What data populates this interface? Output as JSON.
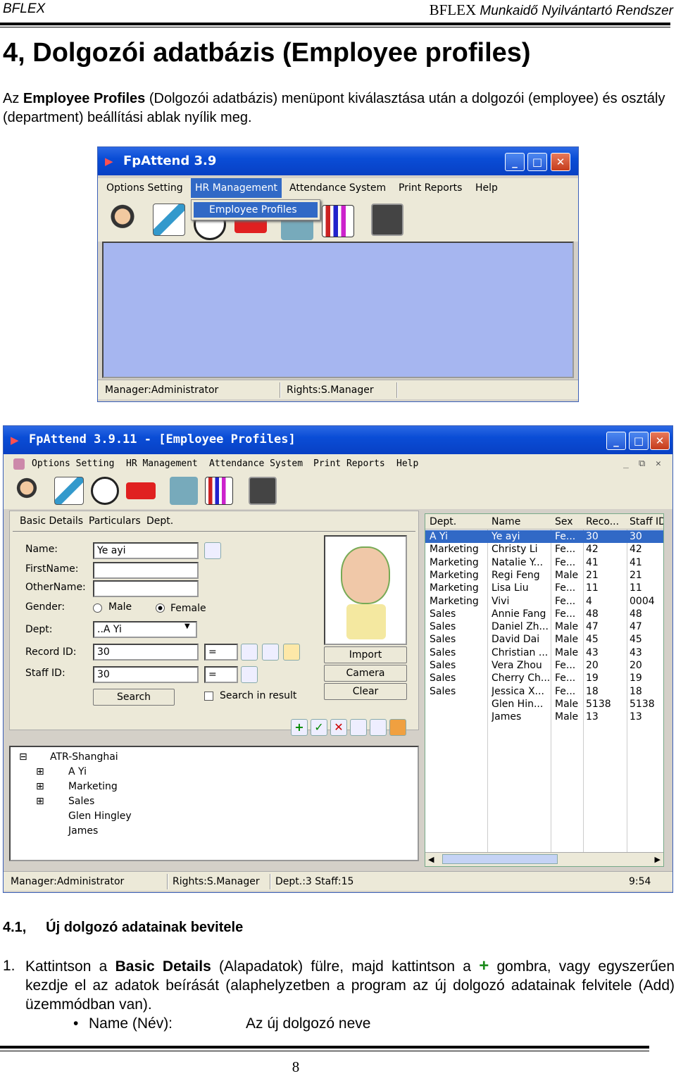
{
  "header": {
    "left": "BFLEX",
    "right_brand": "BFLEX",
    "right_title": "Munkaidő Nyilvántartó Rendszer"
  },
  "section": {
    "title": "4, Dolgozói adatbázis (Employee profiles)",
    "intro_prefix": "Az ",
    "intro_bold": "Employee Profiles",
    "intro_rest": " (Dolgozói adatbázis) menüpont kiválasztása után a dolgozói (employee) és osztály (department) beállítási ablak nyílik meg."
  },
  "screenshot1": {
    "title": "FpAttend 3.9",
    "menu": [
      "Options Setting",
      "HR Management",
      "Attendance System",
      "Print Reports",
      "Help"
    ],
    "dropdown_item": "Employee Profiles",
    "status_manager": "Manager:Administrator",
    "status_rights": "Rights:S.Manager"
  },
  "screenshot2": {
    "title": "FpAttend 3.9.11 - [Employee Profiles]",
    "menu": [
      "Options Setting",
      "HR Management",
      "Attendance System",
      "Print Reports",
      "Help"
    ],
    "tabs": [
      "Basic Details",
      "Particulars",
      "Dept."
    ],
    "form": {
      "name_label": "Name:",
      "name_value": "Ye ayi",
      "firstname_label": "FirstName:",
      "othername_label": "OtherName:",
      "gender_label": "Gender:",
      "male": "Male",
      "female": "Female",
      "dept_label": "Dept:",
      "dept_value": "..A Yi",
      "record_label": "Record ID:",
      "record_value": "30",
      "staff_label": "Staff ID:",
      "staff_value": "30",
      "op": "=",
      "search_button": "Search",
      "search_in_result": "Search in result",
      "import_button": "Import",
      "camera_button": "Camera",
      "clear_button": "Clear"
    },
    "tree": [
      "ATR-Shanghai",
      "A Yi",
      "Marketing",
      "Sales",
      "Glen Hingley",
      "James"
    ],
    "grid": {
      "columns": [
        "Dept.",
        "Name",
        "Sex",
        "Reco...",
        "Staff ID"
      ],
      "rows": [
        [
          "A Yi",
          "Ye ayi",
          "Fe...",
          "30",
          "30"
        ],
        [
          "Marketing",
          "Christy Li",
          "Fe...",
          "42",
          "42"
        ],
        [
          "Marketing",
          "Natalie Y...",
          "Fe...",
          "41",
          "41"
        ],
        [
          "Marketing",
          "Regi Feng",
          "Male",
          "21",
          "21"
        ],
        [
          "Marketing",
          "Lisa Liu",
          "Fe...",
          "11",
          "11"
        ],
        [
          "Marketing",
          "Vivi",
          "Fe...",
          "4",
          "0004"
        ],
        [
          "Sales",
          "Annie Fang",
          "Fe...",
          "48",
          "48"
        ],
        [
          "Sales",
          "Daniel Zh...",
          "Male",
          "47",
          "47"
        ],
        [
          "Sales",
          "David Dai",
          "Male",
          "45",
          "45"
        ],
        [
          "Sales",
          "Christian ...",
          "Male",
          "43",
          "43"
        ],
        [
          "Sales",
          "Vera Zhou",
          "Fe...",
          "20",
          "20"
        ],
        [
          "Sales",
          "Cherry Ch...",
          "Fe...",
          "19",
          "19"
        ],
        [
          "Sales",
          "Jessica X...",
          "Fe...",
          "18",
          "18"
        ],
        [
          "",
          "Glen Hin...",
          "Male",
          "5138",
          "5138"
        ],
        [
          "",
          "James",
          "Male",
          "13",
          "13"
        ]
      ]
    },
    "status_manager": "Manager:Administrator",
    "status_rights": "Rights:S.Manager",
    "status_dept": "Dept.:3  Staff:15",
    "status_time": "9:54"
  },
  "subsection": {
    "title": "4.1,     Új dolgozó adatainak bevitele",
    "item1_num": "1.",
    "item1_a": "Kattintson a ",
    "item1_bold": "Basic Details",
    "item1_b": " (Alapadatok) fülre, majd kattintson a ",
    "item1_plus": "+",
    "item1_c": " gombra, vagy egyszerűen kezdje el az adatok beírását (alaphelyzetben a program az új dolgozó adatainak felvitele (Add) üzemmódban van).",
    "bullet_label": "Name (Név):",
    "bullet_value": "Az új dolgozó neve"
  },
  "footer": {
    "page": "8"
  }
}
